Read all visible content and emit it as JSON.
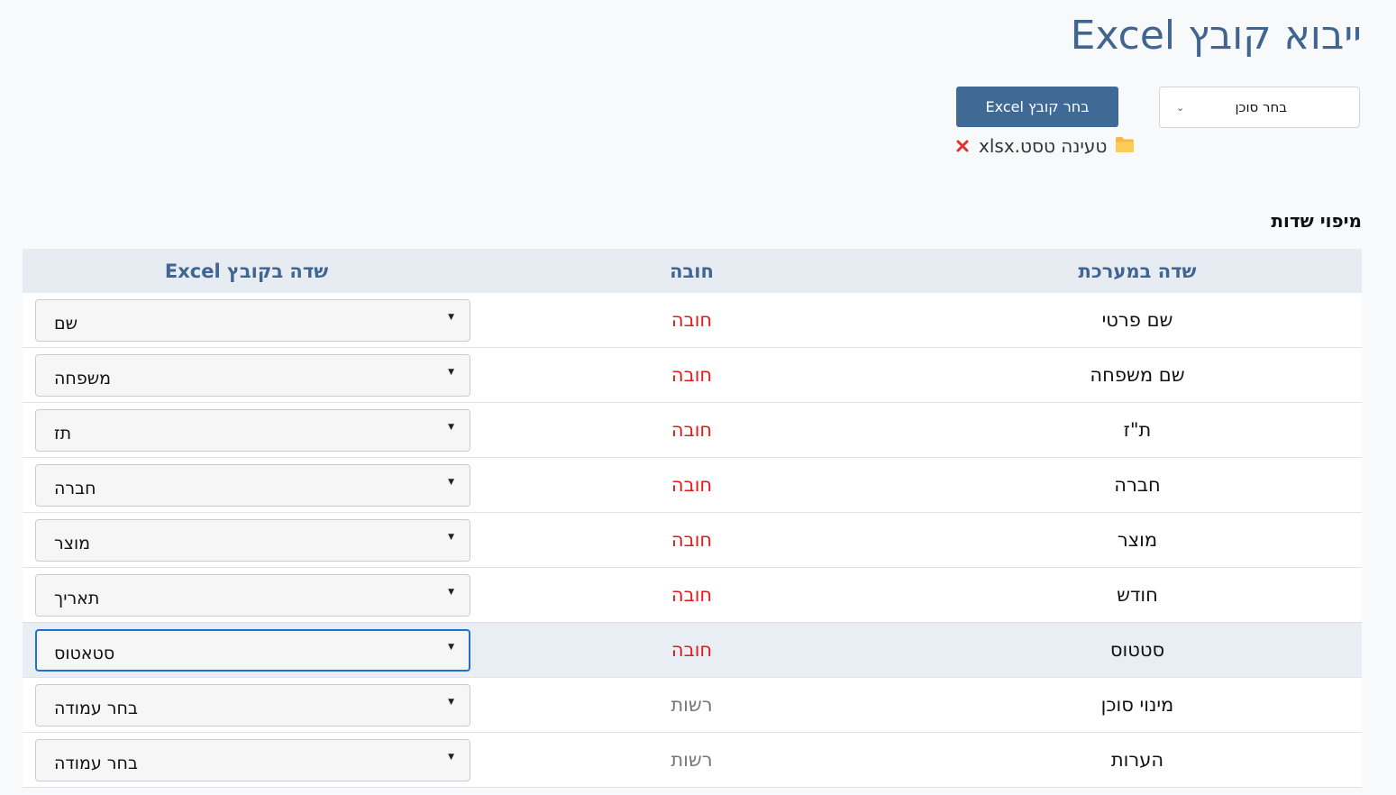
{
  "page": {
    "title": "ייבוא קובץ Excel"
  },
  "controls": {
    "agent_select_label": "בחר סוכן",
    "excel_button_label": "בחר קובץ Excel",
    "file_name": "טעינה טסט.xlsx"
  },
  "mapping": {
    "section_title": "מיפוי שדות",
    "columns": {
      "system_field": "שדה במערכת",
      "required": "חובה",
      "excel_field": "שדה בקובץ Excel"
    },
    "rows": [
      {
        "field": "שם פרטי",
        "required": "חובה",
        "required_flag": true,
        "excel_column": "שם",
        "active": false
      },
      {
        "field": "שם משפחה",
        "required": "חובה",
        "required_flag": true,
        "excel_column": "משפחה",
        "active": false
      },
      {
        "field": "ת\"ז",
        "required": "חובה",
        "required_flag": true,
        "excel_column": "תז",
        "active": false
      },
      {
        "field": "חברה",
        "required": "חובה",
        "required_flag": true,
        "excel_column": "חברה",
        "active": false
      },
      {
        "field": "מוצר",
        "required": "חובה",
        "required_flag": true,
        "excel_column": "מוצר",
        "active": false
      },
      {
        "field": "חודש",
        "required": "חובה",
        "required_flag": true,
        "excel_column": "תאריך",
        "active": false
      },
      {
        "field": "סטטוס",
        "required": "חובה",
        "required_flag": true,
        "excel_column": "סטאטוס",
        "active": true
      },
      {
        "field": "מינוי סוכן",
        "required": "רשות",
        "required_flag": false,
        "excel_column": "בחר עמודה",
        "active": false
      },
      {
        "field": "הערות",
        "required": "רשות",
        "required_flag": false,
        "excel_column": "בחר עמודה",
        "active": false
      }
    ]
  },
  "colors": {
    "title": "#3f6590",
    "button": "#3f6a96",
    "header_bg": "#e6ecf2",
    "required": "#e01b1b",
    "optional": "#777777",
    "focus": "#1f6fd6",
    "remove_icon": "#e03131",
    "folder_icon": "#f5b93f"
  },
  "icons": {
    "agent_select": "chevron-down-icon",
    "file_remove": "close-icon",
    "file": "folder-icon",
    "column_select": "caret-down-icon"
  }
}
